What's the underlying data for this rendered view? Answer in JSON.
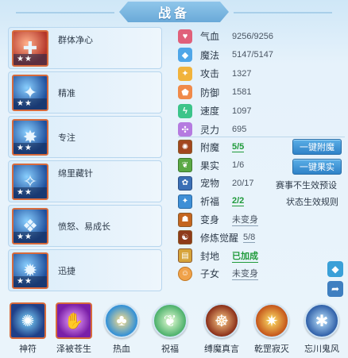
{
  "title": "战备",
  "skills": [
    {
      "name": "群体净心",
      "glyph": "✚",
      "stars": "★★",
      "color": "#e05a3a"
    },
    {
      "name": "精准",
      "glyph": "✦",
      "stars": "★★",
      "color": "#2f7fd8"
    },
    {
      "name": "专注",
      "glyph": "✸",
      "stars": "★★",
      "color": "#3f63b8"
    },
    {
      "name": "绵里藏针",
      "glyph": "✧",
      "stars": "★★",
      "color": "#2d8fd0"
    },
    {
      "name": "愤怒、易成长",
      "glyph": "❖",
      "stars": "★★",
      "color": "#3a76c6"
    },
    {
      "name": "迅捷",
      "glyph": "✹",
      "stars": "★★",
      "color": "#3668bf"
    }
  ],
  "attributes": [
    {
      "label": "气血",
      "value": "9256/9256",
      "icon": "heart-icon",
      "color": "#e0607a",
      "glyph": "♥"
    },
    {
      "label": "魔法",
      "value": "5147/5147",
      "icon": "mana-icon",
      "color": "#4fa6e8",
      "glyph": "◆"
    },
    {
      "label": "攻击",
      "value": "1327",
      "icon": "attack-icon",
      "color": "#f1b33c",
      "glyph": "✦"
    },
    {
      "label": "防御",
      "value": "1581",
      "icon": "defense-icon",
      "color": "#f08a4a",
      "glyph": "⬟"
    },
    {
      "label": "速度",
      "value": "1097",
      "icon": "speed-icon",
      "color": "#3cc48a",
      "glyph": "ϟ"
    },
    {
      "label": "灵力",
      "value": "695",
      "icon": "spirit-icon",
      "color": "#b57be0",
      "glyph": "✣"
    }
  ],
  "rows": [
    {
      "label": "附魔",
      "value": "5/5",
      "style": "green"
    },
    {
      "label": "果实",
      "value": "1/6",
      "style": "plain"
    },
    {
      "label": "宠物",
      "value": "20/17",
      "style": "plain"
    },
    {
      "label": "祈福",
      "value": "2/2",
      "style": "green"
    },
    {
      "label": "变身",
      "value": "未变身",
      "style": "normal"
    },
    {
      "label": "修炼觉醒",
      "value": "5/8",
      "style": "normal"
    },
    {
      "label": "封地",
      "value": "已加成",
      "style": "green"
    },
    {
      "label": "子女",
      "value": "未变身",
      "style": "normal"
    }
  ],
  "buttons": {
    "enchant_all": "一键附魔",
    "fruit_all": "一键果实"
  },
  "links": {
    "tournament_preset": "赛事不生效预设",
    "status_rules": "状态生效规则"
  },
  "bottom": [
    {
      "label": "神符",
      "glyph": "✺",
      "shape": "square",
      "color": "#2c4fa8"
    },
    {
      "label": "泽被苍生",
      "glyph": "✋",
      "shape": "square",
      "color": "#a13ad0"
    },
    {
      "label": "热血",
      "glyph": "♣",
      "shape": "circle",
      "color": "#2f8fd8"
    },
    {
      "label": "祝福",
      "glyph": "❦",
      "shape": "circle",
      "color": "#4bb06a"
    },
    {
      "label": "缚魔真言",
      "glyph": "☸",
      "shape": "circle",
      "color": "#c8552e"
    },
    {
      "label": "乾罡寂灭",
      "glyph": "✷",
      "shape": "circle",
      "color": "#d9771e"
    },
    {
      "label": "忘川鬼风",
      "glyph": "✱",
      "shape": "circle",
      "color": "#2f6fb8"
    }
  ]
}
